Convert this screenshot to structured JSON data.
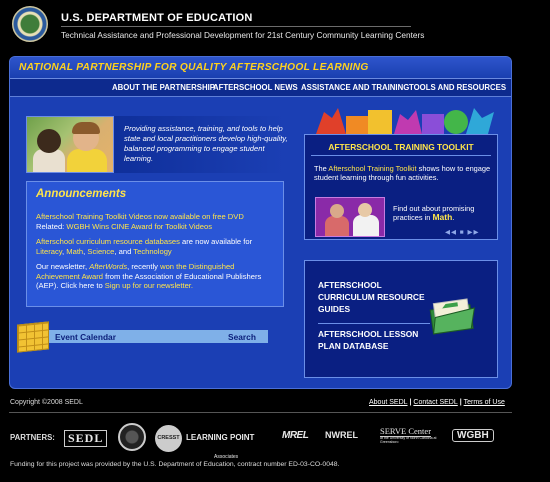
{
  "header": {
    "agency": "U.S. DEPARTMENT OF EDUCATION",
    "subtitle": "Technical Assistance and Professional Development for 21st Century Community Learning Centers"
  },
  "banner": {
    "title": "NATIONAL PARTNERSHIP FOR QUALITY AFTERSCHOOL LEARNING"
  },
  "nav": {
    "items": [
      "ABOUT THE PARTNERSHIP",
      "AFTERSCHOOL NEWS",
      "ASSISTANCE AND TRAINING",
      "TOOLS AND RESOURCES"
    ]
  },
  "hero": {
    "text": "Providing assistance, training, and tools to help state and local practitioners develop high-quality, balanced programming to engage student learning."
  },
  "announcements": {
    "title": "Announcements",
    "item1_link": "Afterschool Training Toolkit Videos now available on free DVD",
    "item1_related_label": "Related: ",
    "item1_related_link": "WGBH Wins CINE Award for Toolkit Videos",
    "item2_link": "Afterschool curriculum resource databases",
    "item2_text": " are now available for ",
    "item2_subjects": [
      "Literacy",
      "Math",
      "Science",
      "Technology"
    ],
    "item3_prefix": "Our newsletter, ",
    "item3_name": "AfterWords",
    "item3_mid": ", recently ",
    "item3_award_link": "won the Distinguished Achievement Award",
    "item3_from": " from the Association of Educational Publishers (AEP). Click here to ",
    "item3_signup_link": "Sign up for our newsletter."
  },
  "calendar": {
    "label": "Event Calendar",
    "search": "Search"
  },
  "toolkit": {
    "heading": "AFTERSCHOOL TRAINING TOOLKIT",
    "desc_prefix": "The ",
    "desc_link": "Afterschool Training Toolkit",
    "desc_suffix": " shows how to engage student learning through fun activities.",
    "find_text": "Find out about promising practices in ",
    "find_subject": "Math",
    "find_end": ".",
    "controls": "◀◀ ■ ▶▶"
  },
  "curriculum": {
    "link1": "AFTERSCHOOL CURRICULUM RESOURCE GUIDES",
    "link2": "AFTERSCHOOL LESSON PLAN DATABASE"
  },
  "footer": {
    "copyright": "Copyright ©2008 SEDL",
    "links": [
      "About SEDL",
      "Contact SEDL",
      "Terms of Use"
    ],
    "sep": " | ",
    "partners_label": "PARTNERS:",
    "partners": [
      "SEDL",
      "CRESST",
      "LEARNING POINT",
      "Associates",
      "MREL",
      "NWREL",
      "SERVE Center",
      "at the University of North Carolina at Greensboro",
      "WGBH"
    ],
    "funding": "Funding for this project was provided by the U.S. Department of Education, contract number ED-03-CO-0048."
  },
  "colors": {
    "panel": "#1b3fb4",
    "accent_yellow": "#ffe54a",
    "banner_yellow": "#ffd21e",
    "box_dark": "#0a1f82"
  }
}
